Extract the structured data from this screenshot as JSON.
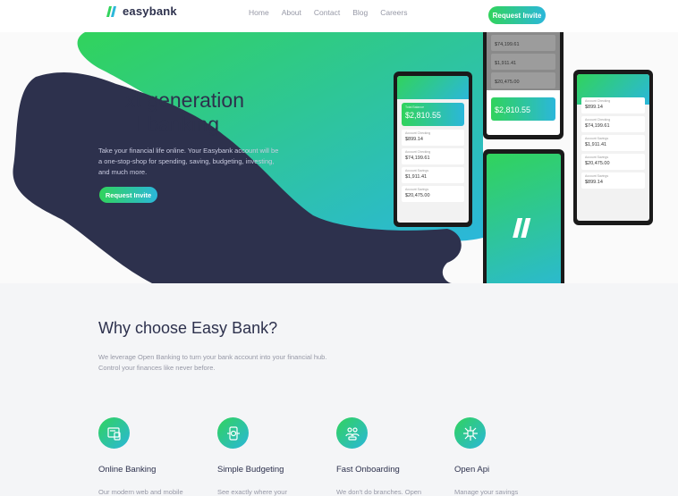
{
  "header": {
    "logo": "easybank",
    "nav": [
      "Home",
      "About",
      "Contact",
      "Blog",
      "Careers"
    ],
    "cta": "Request Invite"
  },
  "hero": {
    "title_line1": "xt generation",
    "title_line2": "l banking",
    "text": "Take your financial life online. Your Easybank account will be a one-stop-shop for spending, saving, budgeting, investing, and much more.",
    "button": "Request Invite"
  },
  "phones": {
    "balance_label": "Total Balance",
    "balance": "$2,810.55",
    "accounts": [
      {
        "label": "Account Checking",
        "value": "$899.14"
      },
      {
        "label": "Account Checking",
        "value": "$74,199.61"
      },
      {
        "label": "Account Savings",
        "value": "$1,911.41"
      },
      {
        "label": "Account Savings",
        "value": "$20,475.00"
      }
    ]
  },
  "why": {
    "title": "Why choose Easy Bank?",
    "text_line1": "We leverage Open Banking to turn your bank account into your financial hub.",
    "text_line2": "Control your finances like never before.",
    "features": [
      {
        "icon": "online-banking-icon",
        "title": "Online Banking",
        "text": "Our modern web and mobile"
      },
      {
        "icon": "budgeting-icon",
        "title": "Simple Budgeting",
        "text": "See exactly where your"
      },
      {
        "icon": "onboarding-icon",
        "title": "Fast Onboarding",
        "text": "We don't do branches. Open"
      },
      {
        "icon": "api-icon",
        "title": "Open Api",
        "text": "Manage your savings"
      }
    ]
  },
  "colors": {
    "dark_blue": "#2d314d",
    "lime_green": "#31d35c",
    "bright_cyan": "#2bb7da",
    "grayish_blue": "#9698a6"
  }
}
